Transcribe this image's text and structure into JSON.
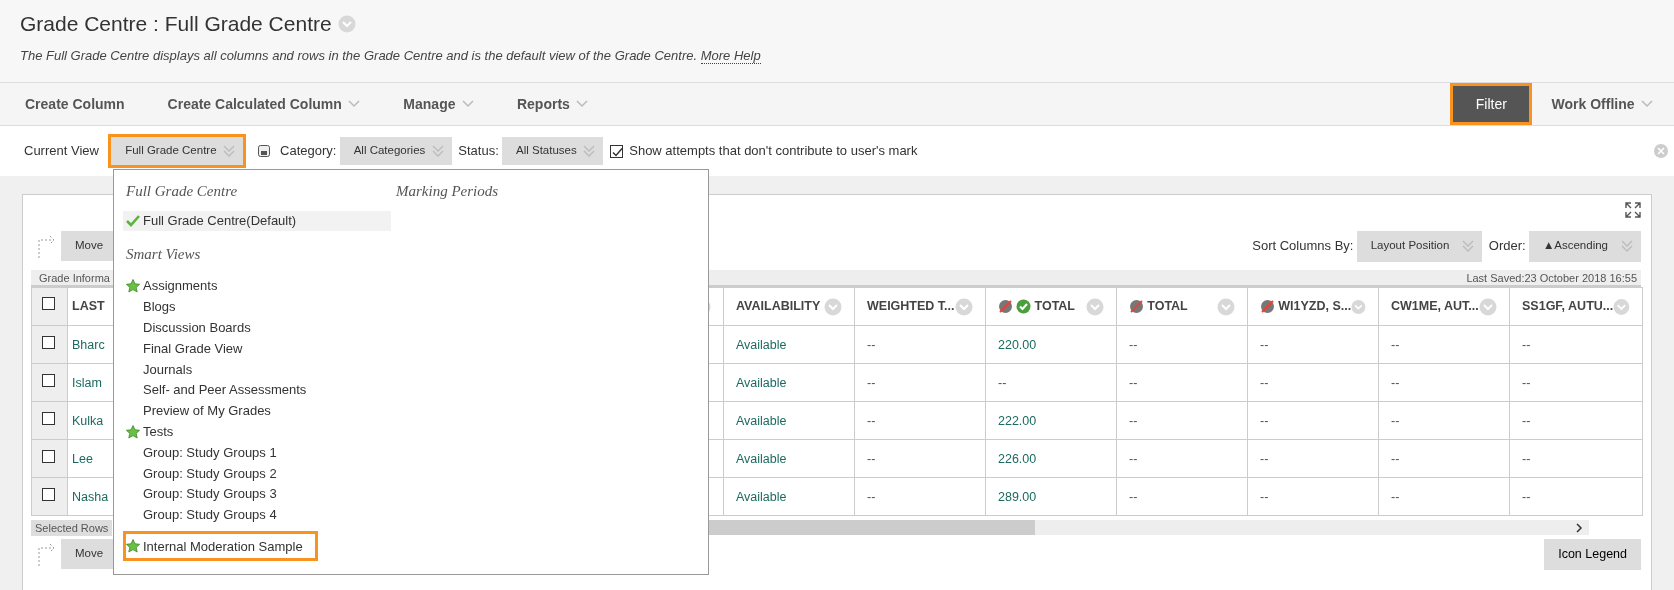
{
  "page": {
    "title": "Grade Centre : Full Grade Centre",
    "description": "The Full Grade Centre displays all columns and rows in the Grade Centre and is the default view of the Grade Centre.",
    "help_link": "More Help"
  },
  "action_bar": {
    "items": [
      {
        "label": "Create Column",
        "has_menu": false
      },
      {
        "label": "Create Calculated Column",
        "has_menu": true
      },
      {
        "label": "Manage",
        "has_menu": true
      },
      {
        "label": "Reports",
        "has_menu": true
      }
    ],
    "right": [
      {
        "label": "Filter",
        "kind": "button",
        "highlighted": true
      },
      {
        "label": "Work Offline",
        "kind": "menu",
        "highlighted": false
      }
    ]
  },
  "filter_bar": {
    "current_view_label": "Current View",
    "current_view": "Full Grade Centre",
    "current_view_highlighted": true,
    "category_label": "Category:",
    "category": "All Categories",
    "status_label": "Status:",
    "status": "All Statuses",
    "show_attempts": {
      "label": "Show attempts that don't contribute to user's mark",
      "checked": true
    }
  },
  "view_menu": {
    "sections": [
      {
        "heading": "Full Grade Centre",
        "items": [
          {
            "label": "Full Grade Centre(Default)",
            "selected": true,
            "favorite": false,
            "highlighted": false
          }
        ]
      },
      {
        "heading": "Smart Views",
        "items": [
          {
            "label": "Assignments",
            "selected": false,
            "favorite": true,
            "highlighted": false
          },
          {
            "label": "Blogs",
            "selected": false,
            "favorite": false,
            "highlighted": false
          },
          {
            "label": "Discussion Boards",
            "selected": false,
            "favorite": false,
            "highlighted": false
          },
          {
            "label": "Final Grade View",
            "selected": false,
            "favorite": false,
            "highlighted": false
          },
          {
            "label": "Journals",
            "selected": false,
            "favorite": false,
            "highlighted": false
          },
          {
            "label": "Self- and Peer Assessments",
            "selected": false,
            "favorite": false,
            "highlighted": false
          },
          {
            "label": "Preview of My Grades",
            "selected": false,
            "favorite": false,
            "highlighted": false
          },
          {
            "label": "Tests",
            "selected": false,
            "favorite": true,
            "highlighted": false
          },
          {
            "label": "Group: Study Groups 1",
            "selected": false,
            "favorite": false,
            "highlighted": false
          },
          {
            "label": "Group: Study Groups 2",
            "selected": false,
            "favorite": false,
            "highlighted": false
          },
          {
            "label": "Group: Study Groups 3",
            "selected": false,
            "favorite": false,
            "highlighted": false
          },
          {
            "label": "Group: Study Groups 4",
            "selected": false,
            "favorite": false,
            "highlighted": false
          },
          {
            "label": "Internal Moderation Sample",
            "selected": false,
            "favorite": true,
            "highlighted": true
          }
        ]
      }
    ],
    "side_heading": "Marking Periods"
  },
  "grid": {
    "move_button": "Move",
    "sort_label": "Sort Columns By:",
    "sort_value": "Layout Position",
    "order_label": "Order:",
    "order_value": "▲Ascending",
    "info_bar": "Grade Informa",
    "last_saved": "Last Saved:23 October 2018 16:55",
    "all_selected": false,
    "columns": [
      {
        "label": "LAST",
        "excluded": false,
        "released": false
      },
      {
        "label": "AVAILABILITY",
        "excluded": false,
        "released": false
      },
      {
        "label": "WEIGHTED T...",
        "excluded": false,
        "released": false
      },
      {
        "label": "TOTAL",
        "excluded": true,
        "released": true
      },
      {
        "label": "TOTAL",
        "excluded": true,
        "released": false
      },
      {
        "label": "WI1YZD, S...",
        "excluded": true,
        "released": false
      },
      {
        "label": "CW1ME, AUT...",
        "excluded": false,
        "released": false
      },
      {
        "label": "SS1GF, AUTU...",
        "excluded": false,
        "released": false
      }
    ],
    "rows": [
      {
        "selected": false,
        "cells": [
          "Bharc",
          "Available",
          "--",
          "220.00",
          "--",
          "--",
          "--",
          "--"
        ]
      },
      {
        "selected": false,
        "cells": [
          "Islam",
          "Available",
          "--",
          "--",
          "--",
          "--",
          "--",
          "--"
        ]
      },
      {
        "selected": false,
        "cells": [
          "Kulka",
          "Available",
          "--",
          "222.00",
          "--",
          "--",
          "--",
          "--"
        ]
      },
      {
        "selected": false,
        "cells": [
          "Lee",
          "Available",
          "--",
          "226.00",
          "--",
          "--",
          "--",
          "--"
        ]
      },
      {
        "selected": false,
        "cells": [
          "Nasha",
          "Available",
          "--",
          "289.00",
          "--",
          "--",
          "--",
          "--"
        ]
      }
    ],
    "selected_rows_label": "Selected Rows",
    "bottom_move_button": "Move",
    "icon_legend": "Icon Legend"
  }
}
